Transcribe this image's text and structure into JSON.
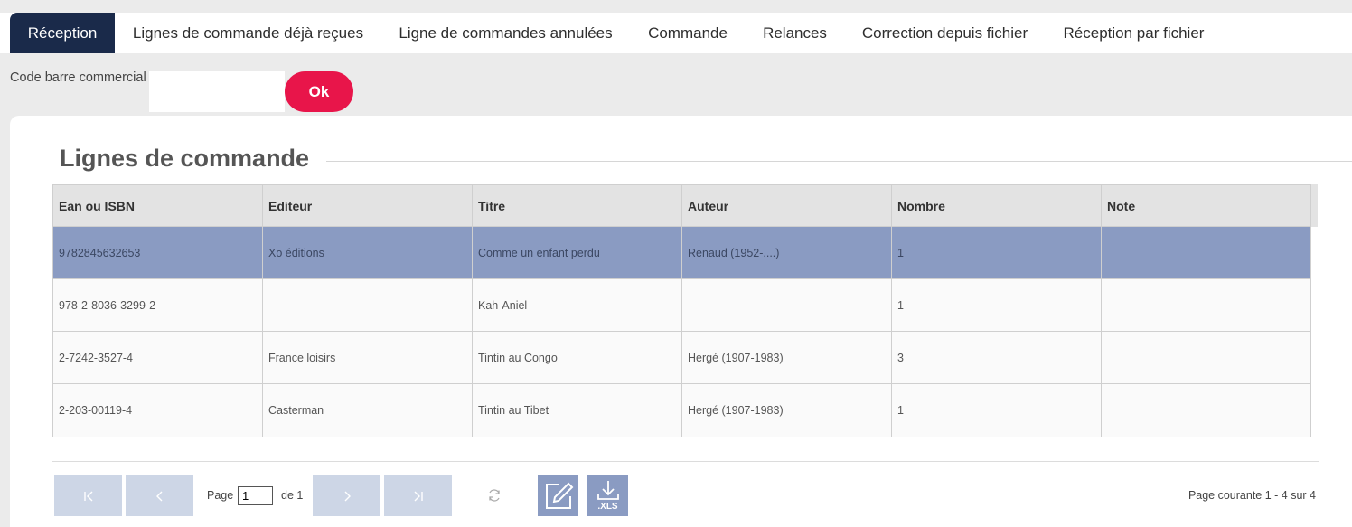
{
  "tabs": [
    {
      "label": "Réception"
    },
    {
      "label": "Lignes de commande déjà reçues"
    },
    {
      "label": "Ligne de commandes annulées"
    },
    {
      "label": "Commande"
    },
    {
      "label": "Relances"
    },
    {
      "label": "Correction depuis fichier"
    },
    {
      "label": "Réception par fichier"
    }
  ],
  "active_tab": "Réception",
  "barcode": {
    "label": "Code barre commercial",
    "value": "",
    "button": "Ok"
  },
  "section": {
    "title": "Lignes de commande"
  },
  "grid": {
    "columns": [
      "Ean ou ISBN",
      "Editeur",
      "Titre",
      "Auteur",
      "Nombre",
      "Note"
    ],
    "rows": [
      {
        "ean": "9782845632653",
        "editeur": "Xo éditions",
        "titre": "Comme un enfant perdu",
        "auteur": "Renaud (1952-....)",
        "nombre": "1",
        "note": "",
        "selected": true
      },
      {
        "ean": "978-2-8036-3299-2",
        "editeur": "",
        "titre": "Kah-Aniel",
        "auteur": "",
        "nombre": "1",
        "note": ""
      },
      {
        "ean": "2-7242-3527-4",
        "editeur": "France loisirs",
        "titre": "Tintin au Congo",
        "auteur": "Hergé (1907-1983)",
        "nombre": "3",
        "note": ""
      },
      {
        "ean": "2-203-00119-4",
        "editeur": "Casterman",
        "titre": "Tintin au Tibet",
        "auteur": "Hergé (1907-1983)",
        "nombre": "1",
        "note": ""
      }
    ]
  },
  "pager": {
    "page_label": "Page",
    "page_value": "1",
    "of_label": "de 1",
    "status": "Page courante 1 - 4 sur 4",
    "xls_label": ".XLS"
  },
  "colors": {
    "nav_active": "#1a2a4a",
    "ok_button": "#e8154a",
    "selected_row": "#8a9bc2",
    "pager_button": "#cdd6e6"
  }
}
